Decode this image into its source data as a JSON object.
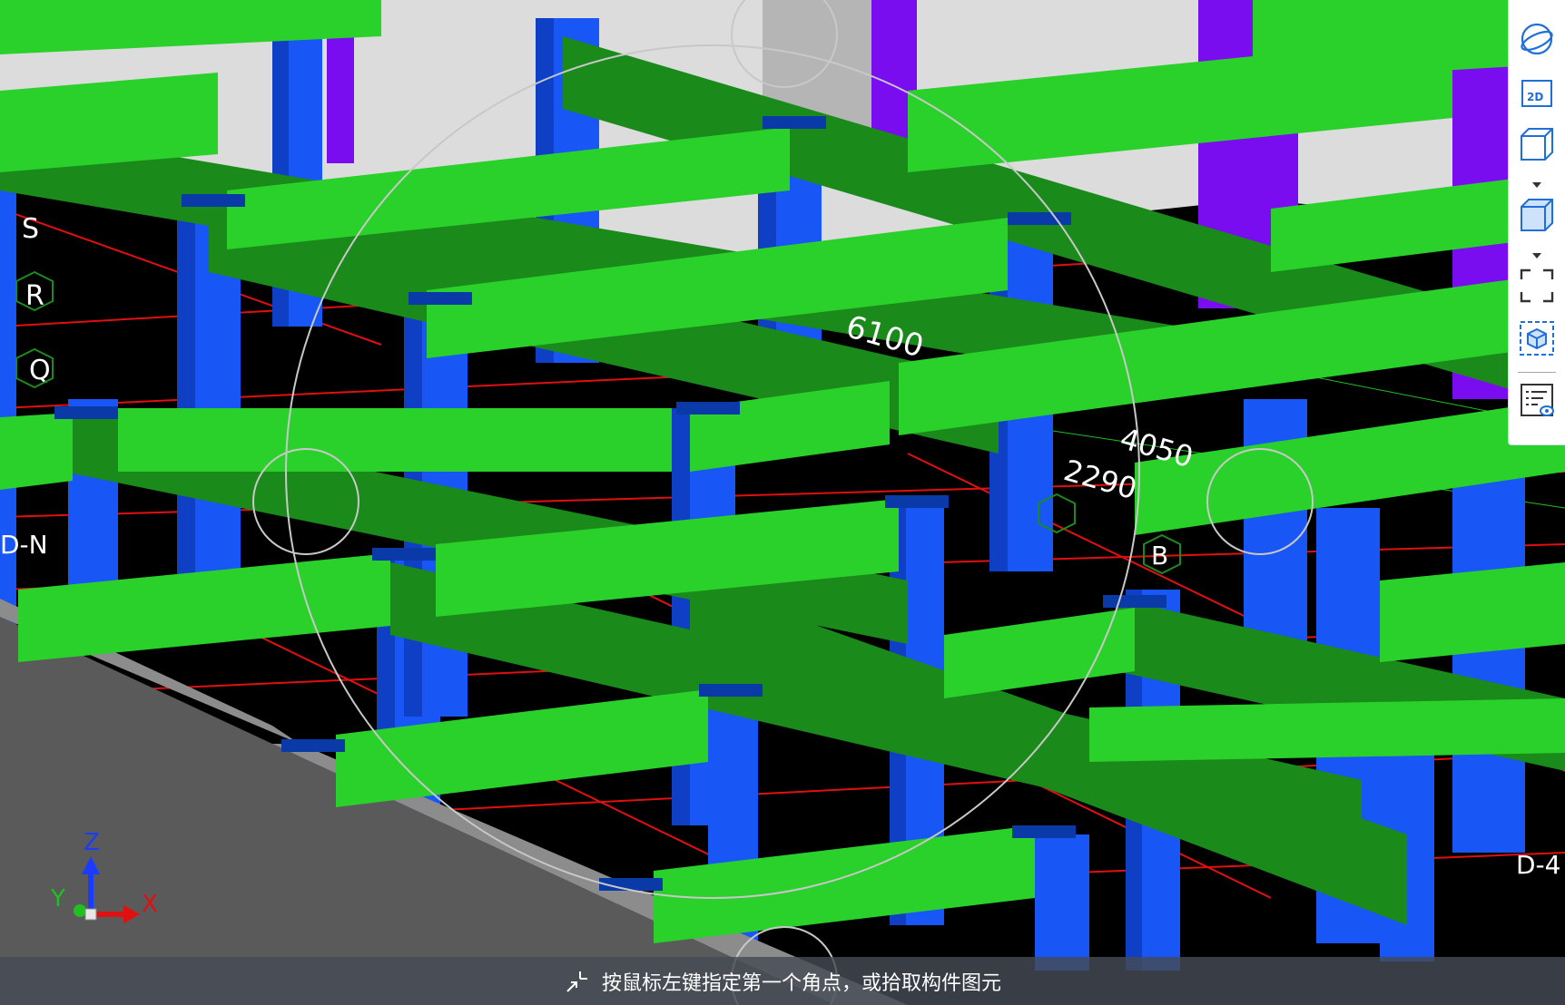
{
  "viewport": {
    "grid_axes": {
      "letters": [
        "S",
        "R",
        "Q",
        "D-N",
        "B",
        "D-4"
      ],
      "dimensions": [
        "6100",
        "4050",
        "2290"
      ]
    },
    "axis_gizmo": {
      "z": "Z",
      "y": "Y",
      "x": "X"
    }
  },
  "toolbar": {
    "buttons": [
      {
        "name": "orbit",
        "icon": "orbit-icon"
      },
      {
        "name": "2d-view",
        "icon": "2d-view-icon",
        "label": "2D"
      },
      {
        "name": "wireframe-cube",
        "icon": "wireframe-cube-icon"
      },
      {
        "name": "solid-cube",
        "icon": "solid-cube-icon"
      },
      {
        "name": "fullscreen",
        "icon": "fullscreen-icon"
      },
      {
        "name": "fit-view",
        "icon": "fit-view-icon"
      },
      {
        "name": "display-settings",
        "icon": "display-settings-icon"
      }
    ]
  },
  "status": {
    "message": "按鼠标左键指定第一个角点，或拾取构件图元",
    "icon": "corner-pick-icon"
  },
  "colors": {
    "beam_light": "#2ad12a",
    "beam_dark": "#1a8a1a",
    "column_blue": "#1856f5",
    "column_purple": "#7a0cf0",
    "wall_gray": "#8c8c8c",
    "grid_red": "#e01010",
    "background": "#000000"
  }
}
